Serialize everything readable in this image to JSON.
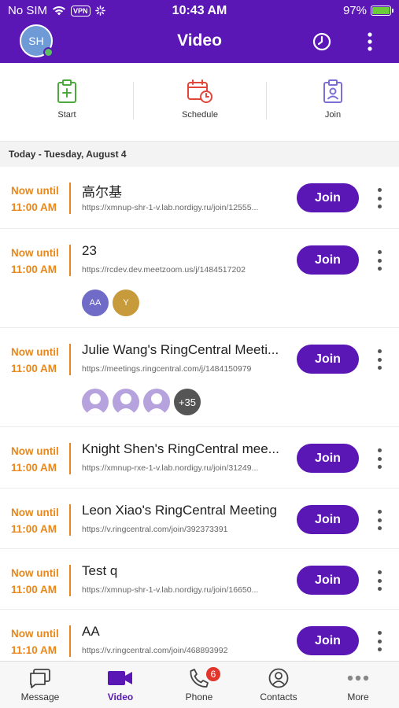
{
  "status_bar": {
    "carrier": "No SIM",
    "vpn": "VPN",
    "time": "10:43 AM",
    "battery": "97%",
    "battery_level": 0.97
  },
  "header": {
    "avatar_initials": "SH",
    "title": "Video",
    "accent_color": "#5a17b6"
  },
  "actions": [
    {
      "label": "Start",
      "icon": "add-calendar-icon"
    },
    {
      "label": "Schedule",
      "icon": "schedule-icon"
    },
    {
      "label": "Join",
      "icon": "join-badge-icon"
    }
  ],
  "date_header": "Today - Tuesday, August 4",
  "meetings": [
    {
      "time_status": "Now until",
      "time": "11:00 AM",
      "title": "高尔基",
      "url": "https://xmnup-shr-1-v.lab.nordigy.ru/join/12555...",
      "join_label": "Join",
      "participants": []
    },
    {
      "time_status": "Now until",
      "time": "11:00 AM",
      "title": "23",
      "url": "https://rcdev.dev.meetzoom.us/j/1484517202",
      "join_label": "Join",
      "participants": [
        "AA",
        "Y"
      ]
    },
    {
      "time_status": "Now until",
      "time": "11:00 AM",
      "title": "Julie Wang's RingCentral Meeti...",
      "url": "https://meetings.ringcentral.com/j/1484150979",
      "join_label": "Join",
      "participants": [
        "",
        "",
        ""
      ],
      "more_count": "+35"
    },
    {
      "time_status": "Now until",
      "time": "11:00 AM",
      "title": "Knight Shen's RingCentral mee...",
      "url": "https://xmnup-rxe-1-v.lab.nordigy.ru/join/31249...",
      "join_label": "Join",
      "participants": []
    },
    {
      "time_status": "Now until",
      "time": "11:00 AM",
      "title": "Leon Xiao's RingCentral Meeting",
      "url": "https://v.ringcentral.com/join/392373391",
      "join_label": "Join",
      "participants": []
    },
    {
      "time_status": "Now until",
      "time": "11:00 AM",
      "title": "Test q",
      "url": "https://xmnup-shr-1-v.lab.nordigy.ru/join/16650...",
      "join_label": "Join",
      "participants": []
    },
    {
      "time_status": "Now until",
      "time": "11:10 AM",
      "title": "AA",
      "url": "https://v.ringcentral.com/join/468893992",
      "join_label": "Join",
      "participants": []
    }
  ],
  "bottom_nav": [
    {
      "label": "Message",
      "icon": "message-icon",
      "active": false
    },
    {
      "label": "Video",
      "icon": "video-icon",
      "active": true
    },
    {
      "label": "Phone",
      "icon": "phone-icon",
      "active": false,
      "badge": "6"
    },
    {
      "label": "Contacts",
      "icon": "contacts-icon",
      "active": false
    },
    {
      "label": "More",
      "icon": "more-dots-icon",
      "active": false
    }
  ]
}
